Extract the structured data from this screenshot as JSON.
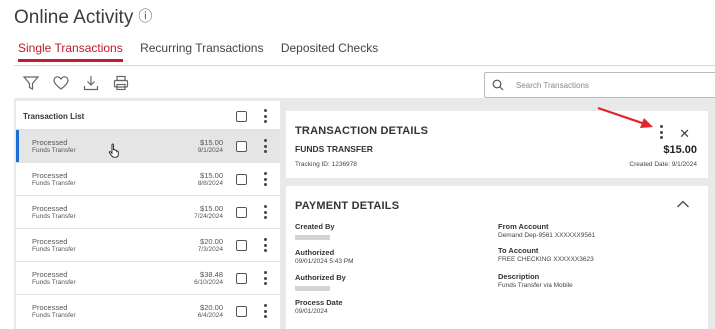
{
  "page": {
    "title": "Online Activity",
    "help_icon": "help-circle-icon"
  },
  "tabs": [
    {
      "label": "Single Transactions",
      "active": true
    },
    {
      "label": "Recurring Transactions",
      "active": false
    },
    {
      "label": "Deposited Checks",
      "active": false
    }
  ],
  "toolbar": {
    "icons": [
      "filter-icon",
      "heart-icon",
      "download-icon",
      "print-icon"
    ]
  },
  "search": {
    "placeholder": "Search Transactions",
    "value": ""
  },
  "transaction_list": {
    "header": "Transaction List",
    "rows": [
      {
        "status": "Processed",
        "type": "Funds Transfer",
        "amount": "$15.00",
        "date": "9/1/2024",
        "selected": true
      },
      {
        "status": "Processed",
        "type": "Funds Transfer",
        "amount": "$15.00",
        "date": "8/8/2024",
        "selected": false
      },
      {
        "status": "Processed",
        "type": "Funds Transfer",
        "amount": "$15.00",
        "date": "7/24/2024",
        "selected": false
      },
      {
        "status": "Processed",
        "type": "Funds Transfer",
        "amount": "$20.00",
        "date": "7/3/2024",
        "selected": false
      },
      {
        "status": "Processed",
        "type": "Funds Transfer",
        "amount": "$38.48",
        "date": "6/10/2024",
        "selected": false
      },
      {
        "status": "Processed",
        "type": "Funds Transfer",
        "amount": "$20.00",
        "date": "6/4/2024",
        "selected": false
      }
    ]
  },
  "transaction_details": {
    "title": "TRANSACTION DETAILS",
    "type": "FUNDS TRANSFER",
    "amount": "$15.00",
    "tracking": "Tracking ID: 1236978",
    "created": "Created Date: 9/1/2024"
  },
  "payment_details": {
    "title": "PAYMENT DETAILS",
    "left": {
      "created_by_label": "Created By",
      "authorized_label": "Authorized",
      "authorized_value": "09/01/2024 5:43 PM",
      "authorized_by_label": "Authorized By",
      "process_date_label": "Process Date",
      "process_date_value": "09/01/2024"
    },
    "right": {
      "from_label": "From Account",
      "from_value": "Demand Dep-9561 XXXXXX9561",
      "to_label": "To Account",
      "to_value": "FREE CHECKING XXXXXX3623",
      "description_label": "Description",
      "description_value": "Funds Transfer via Mobile"
    }
  },
  "colors": {
    "accent": "#c01a2c",
    "selected_bar": "#1a6ed8",
    "annotation_arrow": "#e0252b",
    "panel_bg": "#e9e9e9"
  }
}
